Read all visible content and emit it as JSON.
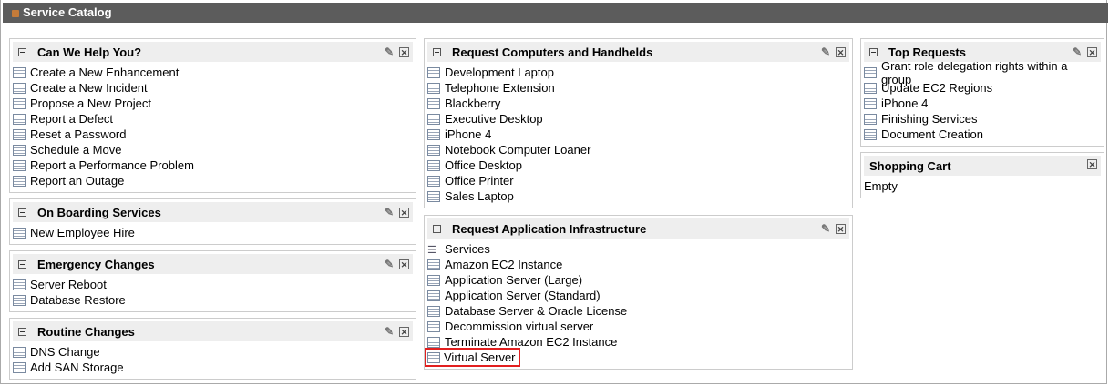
{
  "title": "Service Catalog",
  "col1": [
    {
      "title": "Can We Help You?",
      "items": [
        "Create a New Enhancement",
        "Create a New Incident",
        "Propose a New Project",
        "Report a Defect",
        "Reset a Password",
        "Schedule a Move",
        "Report a Performance Problem",
        "Report an Outage"
      ]
    },
    {
      "title": "On Boarding Services",
      "items": [
        "New Employee Hire"
      ]
    },
    {
      "title": "Emergency Changes",
      "items": [
        "Server Reboot",
        "Database Restore"
      ]
    },
    {
      "title": "Routine Changes",
      "items": [
        "DNS Change",
        "Add SAN Storage"
      ]
    }
  ],
  "col2": [
    {
      "title": "Request Computers and Handhelds",
      "items": [
        "Development Laptop",
        "Telephone Extension",
        "Blackberry",
        "Executive Desktop",
        "iPhone 4",
        "Notebook Computer Loaner",
        "Office Desktop",
        "Office Printer",
        "Sales Laptop"
      ]
    },
    {
      "title": "Request Application Infrastructure",
      "items": [
        "Services",
        "Amazon EC2 Instance",
        "Application Server (Large)",
        "Application Server (Standard)",
        "Database Server & Oracle License",
        "Decommission virtual server",
        "Terminate Amazon EC2 Instance",
        "Virtual Server"
      ]
    }
  ],
  "col3": [
    {
      "title": "Top Requests",
      "items": [
        "Grant role delegation rights within a group",
        "Update EC2 Regions",
        "iPhone 4",
        "Finishing Services",
        "Document Creation"
      ]
    }
  ],
  "cart": {
    "title": "Shopping Cart",
    "status": "Empty"
  },
  "highlighted": "Virtual Server"
}
